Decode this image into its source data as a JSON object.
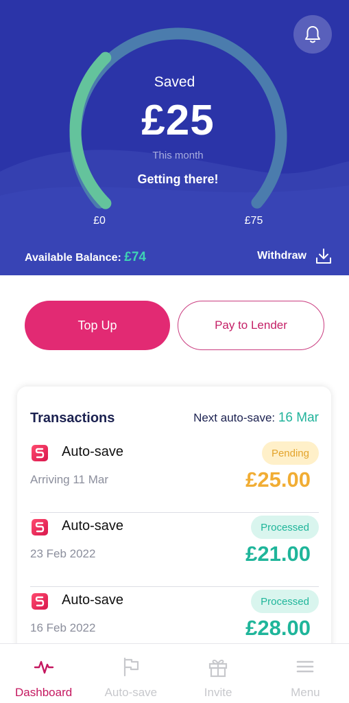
{
  "hero": {
    "saved_label": "Saved",
    "saved_amount": "£25",
    "period": "This month",
    "status": "Getting there!",
    "gauge_min": "£0",
    "gauge_max": "£75",
    "progress_fraction": 0.333,
    "balance_label": "Available Balance:",
    "balance_amount": "£74",
    "withdraw_label": "Withdraw"
  },
  "actions": {
    "top_up": "Top Up",
    "pay_lender": "Pay to Lender"
  },
  "transactions": {
    "title": "Transactions",
    "next_label": "Next auto-save:",
    "next_date": "16 Mar",
    "items": [
      {
        "title": "Auto-save",
        "date": "Arriving 11 Mar",
        "status": "Pending",
        "amount": "£25.00"
      },
      {
        "title": "Auto-save",
        "date": "23 Feb 2022",
        "status": "Processed",
        "amount": "£21.00"
      },
      {
        "title": "Auto-save",
        "date": "16 Feb 2022",
        "status": "Processed",
        "amount": "£28.00"
      }
    ]
  },
  "tabs": [
    {
      "label": "Dashboard",
      "icon": "activity-icon",
      "active": true
    },
    {
      "label": "Auto-save",
      "icon": "flag-icon",
      "active": false
    },
    {
      "label": "Invite",
      "icon": "gift-icon",
      "active": false
    },
    {
      "label": "Menu",
      "icon": "menu-icon",
      "active": false
    }
  ],
  "colors": {
    "hero_bg": "#2b34a8",
    "accent_pink": "#e22a73",
    "teal": "#1fb59a",
    "pending_amber": "#f1ad34"
  }
}
